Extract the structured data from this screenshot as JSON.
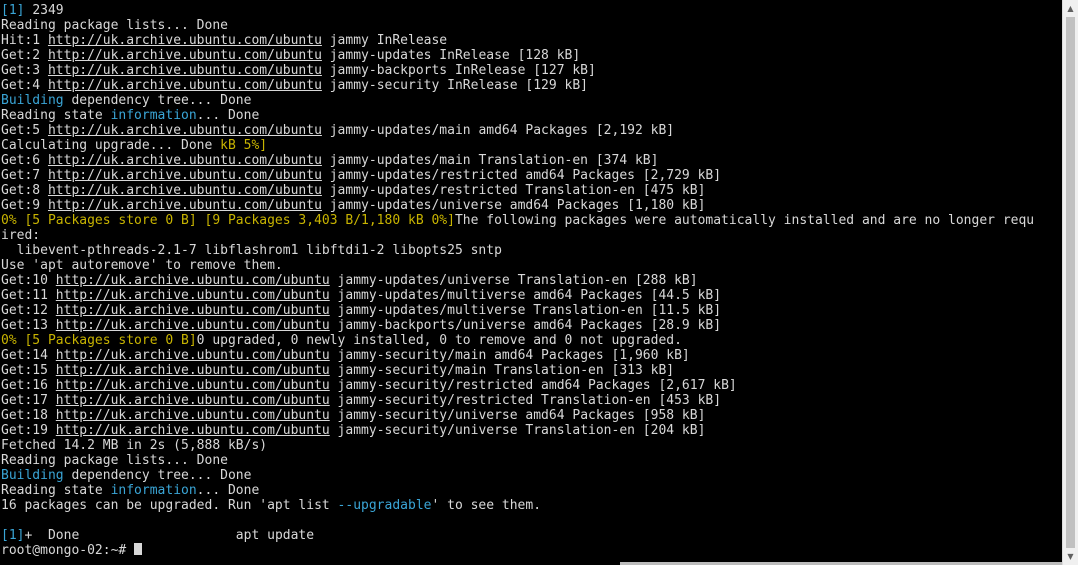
{
  "url": "http://uk.archive.ubuntu.com/ubuntu",
  "job_id": "[1]",
  "pid": "2349",
  "l_reading1": "Reading package lists... Done",
  "hits": [
    {
      "p": "Hit:1 ",
      "s": " jammy InRelease"
    },
    {
      "p": "Get:2 ",
      "s": " jammy-updates InRelease [128 kB]"
    },
    {
      "p": "Get:3 ",
      "s": " jammy-backports InRelease [127 kB]"
    },
    {
      "p": "Get:4 ",
      "s": " jammy-security InRelease [129 kB]"
    }
  ],
  "building": "Building",
  "dep_tree": " dependency tree... Done",
  "reading_state": "Reading state ",
  "information": "information",
  "done_suffix": "... Done",
  "get5": {
    "p": "Get:5 ",
    "s": " jammy-updates/main amd64 Packages [2,192 kB]"
  },
  "calc": "Calculating upgrade... Done ",
  "calc_progress": "kB 5%]",
  "gets6": [
    {
      "p": "Get:6 ",
      "s": " jammy-updates/main Translation-en [374 kB]"
    },
    {
      "p": "Get:7 ",
      "s": " jammy-updates/restricted amd64 Packages [2,729 kB]"
    },
    {
      "p": "Get:8 ",
      "s": " jammy-updates/restricted Translation-en [475 kB]"
    },
    {
      "p": "Get:9 ",
      "s": " jammy-updates/universe amd64 Packages [1,180 kB]"
    }
  ],
  "progress1": "0% [5 Packages store 0 B] [9 Packages 3,403 B/1,180 kB 0%]",
  "following": "The following packages were automatically installed and are no longer requ",
  "ired": "ired:",
  "pkgs": "  libevent-pthreads-2.1-7 libflashrom1 libftdi1-2 libopts25 sntp",
  "autoremove": "Use 'apt autoremove' to remove them.",
  "gets10": [
    {
      "p": "Get:10 ",
      "s": " jammy-updates/universe Translation-en [288 kB]"
    },
    {
      "p": "Get:11 ",
      "s": " jammy-updates/multiverse amd64 Packages [44.5 kB]"
    },
    {
      "p": "Get:12 ",
      "s": " jammy-updates/multiverse Translation-en [11.5 kB]"
    },
    {
      "p": "Get:13 ",
      "s": " jammy-backports/universe amd64 Packages [28.9 kB]"
    }
  ],
  "progress2": "0% [5 Packages store 0 B]",
  "upgraded": "0 upgraded, 0 newly installed, 0 to remove and 0 not upgraded.",
  "gets14": [
    {
      "p": "Get:14 ",
      "s": " jammy-security/main amd64 Packages [1,960 kB]"
    },
    {
      "p": "Get:15 ",
      "s": " jammy-security/main Translation-en [313 kB]"
    },
    {
      "p": "Get:16 ",
      "s": " jammy-security/restricted amd64 Packages [2,617 kB]"
    },
    {
      "p": "Get:17 ",
      "s": " jammy-security/restricted Translation-en [453 kB]"
    },
    {
      "p": "Get:18 ",
      "s": " jammy-security/universe amd64 Packages [958 kB]"
    },
    {
      "p": "Get:19 ",
      "s": " jammy-security/universe Translation-en [204 kB]"
    }
  ],
  "fetched": "Fetched 14.2 MB in 2s (5,888 kB/s)",
  "l_reading2": "Reading package lists... Done",
  "upgradable_pre": "16 packages can be upgraded. Run 'apt list ",
  "upgradable_flag": "--upgradable",
  "upgradable_post": "' to see them.",
  "job_done_id": "[1]",
  "job_done": "+  Done                    apt update",
  "prompt": "root@mongo-02:~# "
}
